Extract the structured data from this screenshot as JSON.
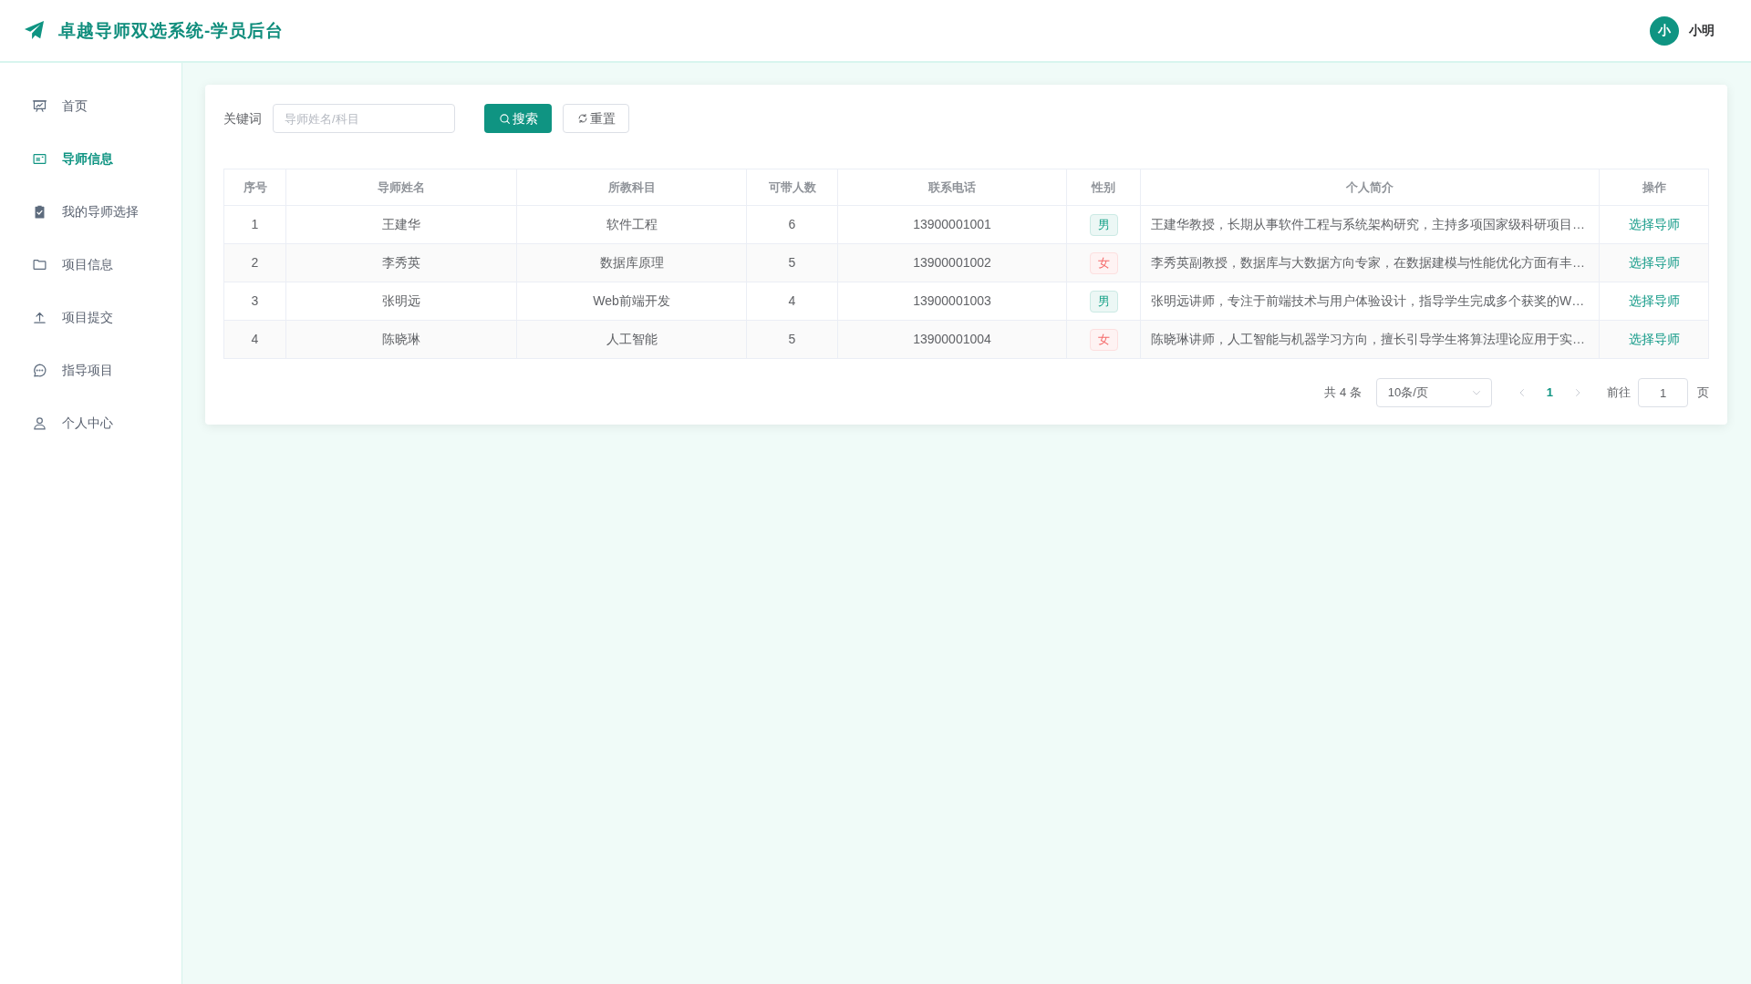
{
  "header": {
    "title": "卓越导师双选系统-学员后台",
    "user": {
      "avatar_text": "小",
      "name": "小明"
    }
  },
  "sidebar": {
    "items": [
      {
        "label": "首页",
        "selected": false
      },
      {
        "label": "导师信息",
        "selected": true
      },
      {
        "label": "我的导师选择",
        "selected": false
      },
      {
        "label": "项目信息",
        "selected": false
      },
      {
        "label": "项目提交",
        "selected": false
      },
      {
        "label": "指导项目",
        "selected": false
      },
      {
        "label": "个人中心",
        "selected": false
      }
    ]
  },
  "search": {
    "label": "关键词",
    "placeholder": "导师姓名/科目",
    "buttons": [
      {
        "kind": "search",
        "label": "搜索"
      },
      {
        "kind": "reset",
        "label": "重置"
      }
    ]
  },
  "table": {
    "columns": [
      "序号",
      "导师姓名",
      "所教科目",
      "可带人数",
      "联系电话",
      "性别",
      "个人简介",
      "操作"
    ],
    "rows": [
      {
        "index": "1",
        "name": "王建华",
        "subject": "软件工程",
        "capacity": "6",
        "phone": "13900001001",
        "gender": {
          "label": "男",
          "color": "#13a086"
        },
        "intro": "王建华教授，长期从事软件工程与系统架构研究，主持多项国家级科研项目…",
        "action": "选择导师"
      },
      {
        "index": "2",
        "name": "李秀英",
        "subject": "数据库原理",
        "capacity": "5",
        "phone": "13900001002",
        "gender": {
          "label": "女",
          "color": "#f56c6c"
        },
        "intro": "李秀英副教授，数据库与大数据方向专家，在数据建模与性能优化方面有丰…",
        "action": "选择导师"
      },
      {
        "index": "3",
        "name": "张明远",
        "subject": "Web前端开发",
        "capacity": "4",
        "phone": "13900001003",
        "gender": {
          "label": "男",
          "color": "#13a086"
        },
        "intro": "张明远讲师，专注于前端技术与用户体验设计，指导学生完成多个获奖的W…",
        "action": "选择导师"
      },
      {
        "index": "4",
        "name": "陈晓琳",
        "subject": "人工智能",
        "capacity": "5",
        "phone": "13900001004",
        "gender": {
          "label": "女",
          "color": "#f56c6c"
        },
        "intro": "陈晓琳讲师，人工智能与机器学习方向，擅长引导学生将算法理论应用于实…",
        "action": "选择导师"
      }
    ]
  },
  "pagination": {
    "total": "共 4 条",
    "page_size": "10条/页",
    "prev": {
      "disabled": true
    },
    "pages": [
      {
        "label": "1",
        "selected": true
      }
    ],
    "next": {
      "disabled": true
    },
    "goto_label": "前往",
    "goto_value": "1",
    "goto_suffix": "页"
  }
}
